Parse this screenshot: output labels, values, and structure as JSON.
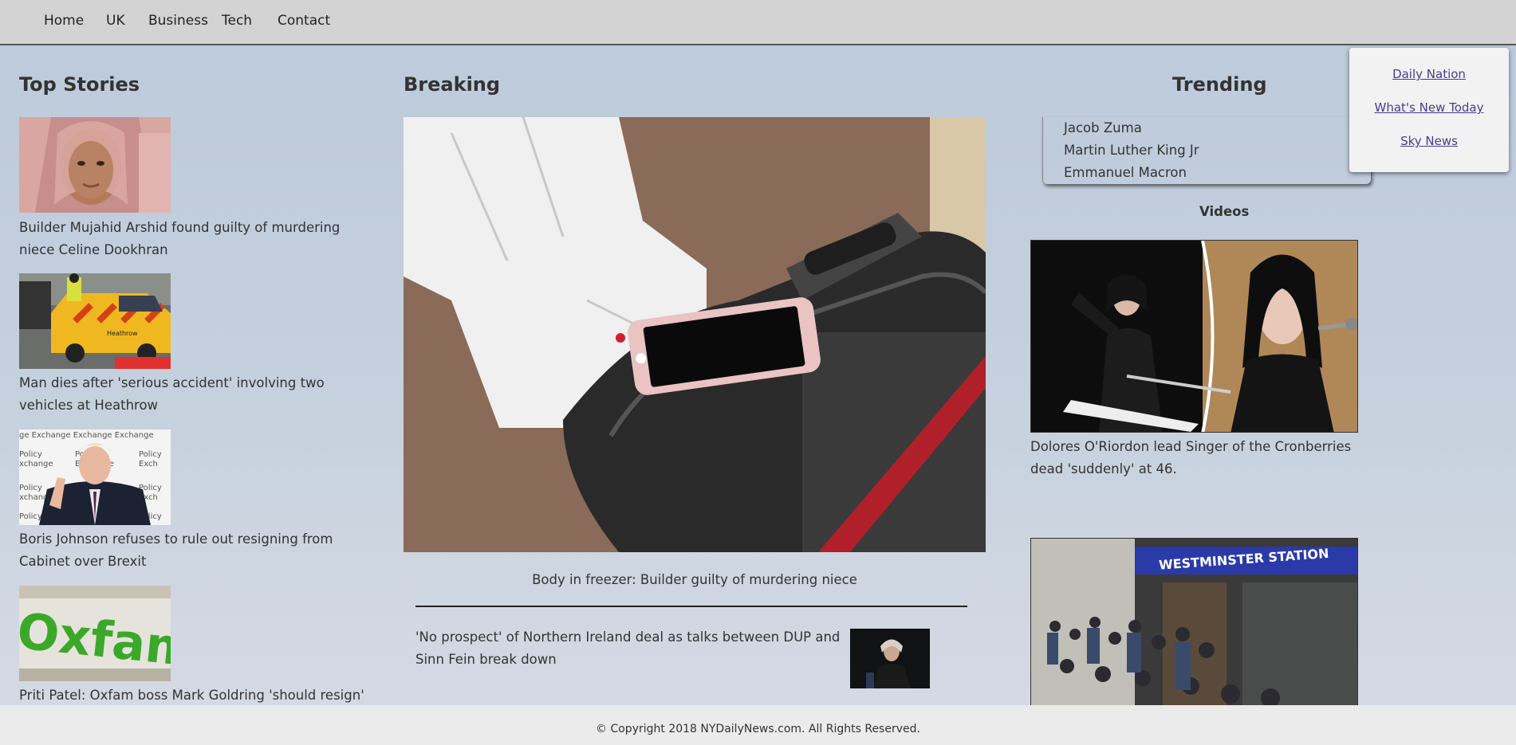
{
  "nav": {
    "items": [
      {
        "label": "Home"
      },
      {
        "label": "UK"
      },
      {
        "label": "Business"
      },
      {
        "label": "Tech"
      },
      {
        "label": "Contact"
      }
    ]
  },
  "sections": {
    "top_stories": "Top Stories",
    "breaking": "Breaking",
    "trending": "Trending",
    "videos": "Videos"
  },
  "top_stories": [
    {
      "headline": "Builder Mujahid Arshid found guilty of murdering niece Celine Dookhran"
    },
    {
      "headline": "Man dies after 'serious accident' involving two vehicles at Heathrow"
    },
    {
      "headline": "Boris Johnson refuses to rule out resigning from Cabinet over Brexit"
    },
    {
      "headline": "Priti Patel: Oxfam boss Mark Goldring 'should resign'"
    }
  ],
  "breaking": {
    "main_caption": "Body in freezer: Builder guilty of murdering niece",
    "secondary_headline": "'No prospect' of Northern Ireland deal as talks between DUP and Sinn Fein break down"
  },
  "trending": [
    "Jacob Zuma",
    "Martin Luther King Jr",
    "Emmanuel Macron"
  ],
  "videos": [
    {
      "caption": "Dolores O'Riordon lead Singer of the Cronberries dead 'suddenly' at 46."
    },
    {
      "station_sign": "WESTMINSTER STATION"
    }
  ],
  "image_text": {
    "heathrow_car": "Heathrow",
    "policy_exchange": "Policy Exchange",
    "oxfam_sign": "Oxfam"
  },
  "dropdown": {
    "items": [
      {
        "label": "Daily Nation"
      },
      {
        "label": "What's New Today"
      },
      {
        "label": "Sky News"
      }
    ]
  },
  "footer": {
    "copyright": "© Copyright 2018 NYDailyNews.com. All Rights Reserved."
  },
  "colors": {
    "nav_bg": "#d3d3d3",
    "link_purple": "#4b3a8f",
    "footer_bg": "#ebebeb"
  }
}
